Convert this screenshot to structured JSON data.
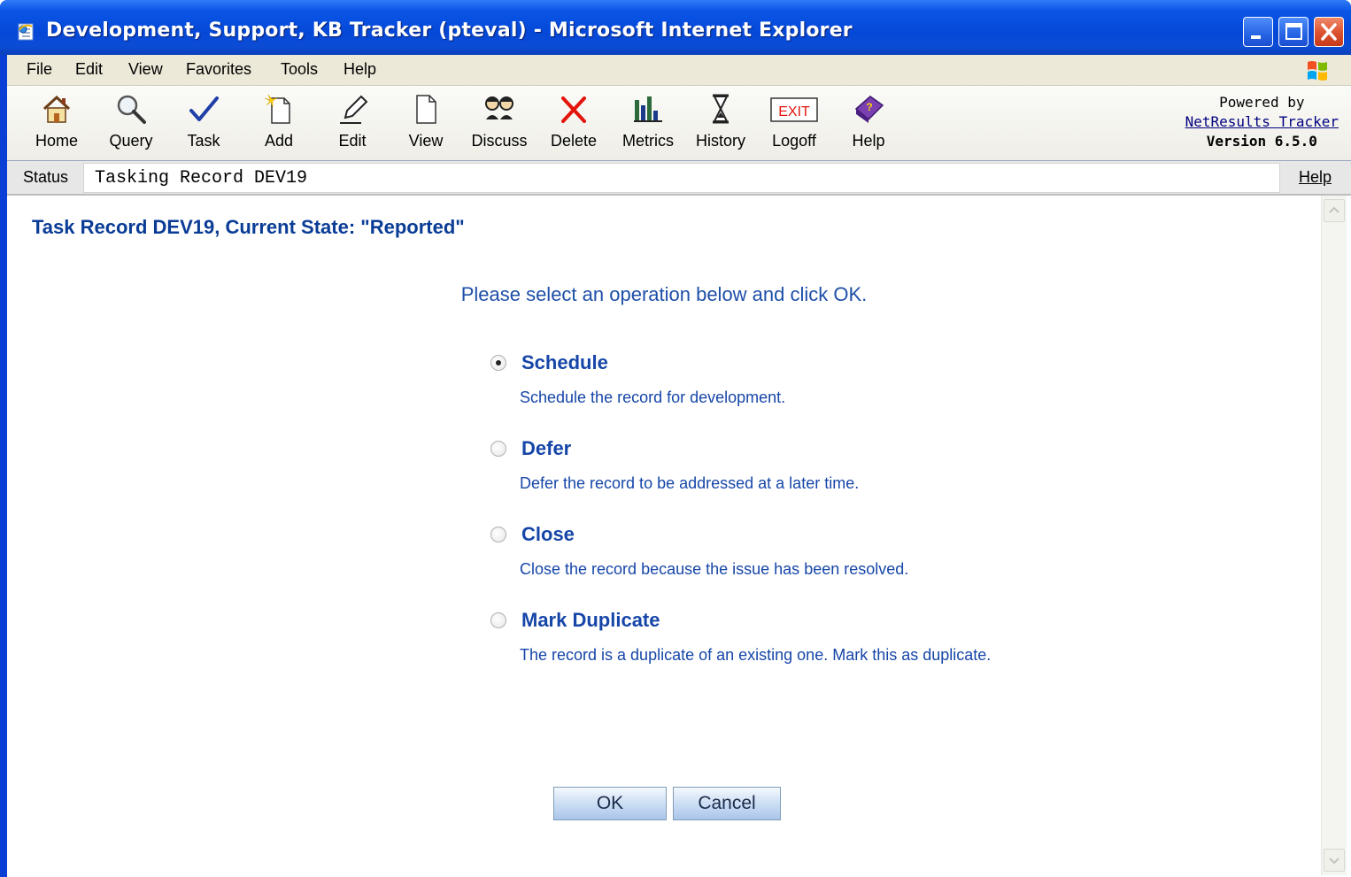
{
  "window": {
    "title": "Development, Support, KB Tracker (pteval) - Microsoft Internet Explorer"
  },
  "menu": [
    "File",
    "Edit",
    "View",
    "Favorites",
    "Tools",
    "Help"
  ],
  "toolbar": {
    "buttons": [
      {
        "label": "Home",
        "icon": "home-icon"
      },
      {
        "label": "Query",
        "icon": "magnifier-icon"
      },
      {
        "label": "Task",
        "icon": "checkmark-icon"
      },
      {
        "label": "Add",
        "icon": "new-document-icon"
      },
      {
        "label": "Edit",
        "icon": "pencil-icon"
      },
      {
        "label": "View",
        "icon": "document-icon"
      },
      {
        "label": "Discuss",
        "icon": "people-icon"
      },
      {
        "label": "Delete",
        "icon": "red-x-icon"
      },
      {
        "label": "Metrics",
        "icon": "bar-chart-icon"
      },
      {
        "label": "History",
        "icon": "hourglass-icon"
      },
      {
        "label": "Logoff",
        "icon": "exit-sign-icon"
      },
      {
        "label": "Help",
        "icon": "help-book-icon"
      }
    ],
    "exit_sign_text": "EXIT",
    "powered_by": "Powered by",
    "product_link": "NetResults Tracker",
    "version": "Version 6.5.0"
  },
  "status": {
    "label": "Status",
    "text": "Tasking Record DEV19",
    "help": "Help"
  },
  "page": {
    "title": "Task Record DEV19, Current State: \"Reported\"",
    "instruction": "Please select an operation below and click OK.",
    "options": [
      {
        "label": "Schedule",
        "description": "Schedule the record for development.",
        "checked": true
      },
      {
        "label": "Defer",
        "description": "Defer the record to be addressed at a later time.",
        "checked": false
      },
      {
        "label": "Close",
        "description": "Close the record because the issue has been resolved.",
        "checked": false
      },
      {
        "label": "Mark Duplicate",
        "description": "The record is a duplicate of an existing one. Mark this as duplicate.",
        "checked": false
      }
    ],
    "ok_label": "OK",
    "cancel_label": "Cancel"
  },
  "colors": {
    "title_bar": "#0a55e6",
    "link_blue": "#1646a8",
    "heading_blue": "#0a3c96"
  }
}
